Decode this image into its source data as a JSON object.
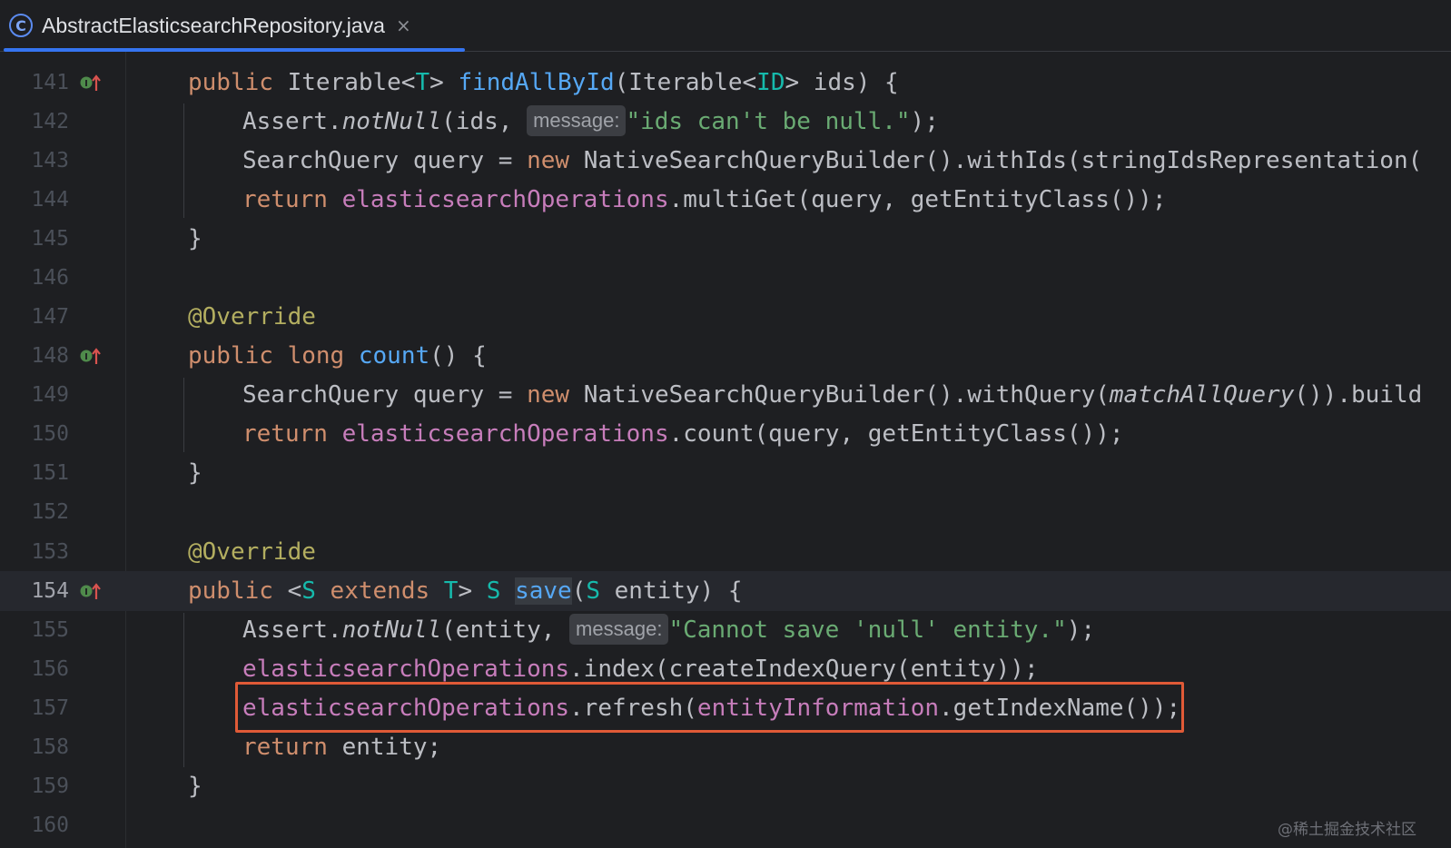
{
  "tab": {
    "title": "AbstractElasticsearchRepository.java",
    "close": "×",
    "icon": "C"
  },
  "gutter_icon": "implementing-method-icon",
  "current_line": "154",
  "lines": [
    {
      "num": "141",
      "icon": true
    },
    {
      "num": "142"
    },
    {
      "num": "143"
    },
    {
      "num": "144"
    },
    {
      "num": "145"
    },
    {
      "num": "146"
    },
    {
      "num": "147"
    },
    {
      "num": "148",
      "icon": true
    },
    {
      "num": "149"
    },
    {
      "num": "150"
    },
    {
      "num": "151"
    },
    {
      "num": "152"
    },
    {
      "num": "153"
    },
    {
      "num": "154",
      "icon": true
    },
    {
      "num": "155"
    },
    {
      "num": "156"
    },
    {
      "num": "157"
    },
    {
      "num": "158"
    },
    {
      "num": "159"
    },
    {
      "num": "160"
    }
  ],
  "code": {
    "l141": [
      "public",
      " Iterable<",
      "T",
      "> ",
      "findAllById",
      "(Iterable<",
      "ID",
      "> ids) {"
    ],
    "l142": [
      "Assert.",
      "notNull",
      "(ids, ",
      "message:",
      "\"ids can't be null.\"",
      ");"
    ],
    "l143": [
      "SearchQuery query = ",
      "new",
      " NativeSearchQueryBuilder().withIds(stringIdsRepresentation("
    ],
    "l144": [
      "return",
      " ",
      "elasticsearchOperations",
      ".multiGet(query, getEntityClass());"
    ],
    "l145": "}",
    "l147": "@Override",
    "l148": [
      "public",
      " ",
      "long",
      " ",
      "count",
      "() {"
    ],
    "l149": [
      "SearchQuery query = ",
      "new",
      " NativeSearchQueryBuilder().withQuery(",
      "matchAllQuery",
      "()).build"
    ],
    "l150": [
      "return",
      " ",
      "elasticsearchOperations",
      ".count(query, getEntityClass());"
    ],
    "l151": "}",
    "l153": "@Override",
    "l154": [
      "public",
      " <",
      "S",
      " ",
      "extends",
      " ",
      "T",
      "> ",
      "S",
      " ",
      "save",
      "(",
      "S",
      " entity) {"
    ],
    "l155": [
      "Assert.",
      "notNull",
      "(entity, ",
      "message:",
      "\"Cannot save 'null' entity.\"",
      ");"
    ],
    "l156": [
      "elasticsearchOperations",
      ".index(createIndexQuery(entity));"
    ],
    "l157": [
      "elasticsearchOperations",
      ".refresh(",
      "entityInformation",
      ".getIndexName());"
    ],
    "l158": [
      "return",
      " entity;"
    ],
    "l159": "}"
  },
  "watermark": "@稀土掘金技术社区",
  "colors": {
    "keyword": "#cf8e6d",
    "function": "#56a8f5",
    "type_param": "#16baac",
    "string": "#6aab73",
    "annotation": "#b3ae60",
    "field": "#c77dbb",
    "highlight": "#e05a37",
    "tab_accent": "#3574f0"
  }
}
